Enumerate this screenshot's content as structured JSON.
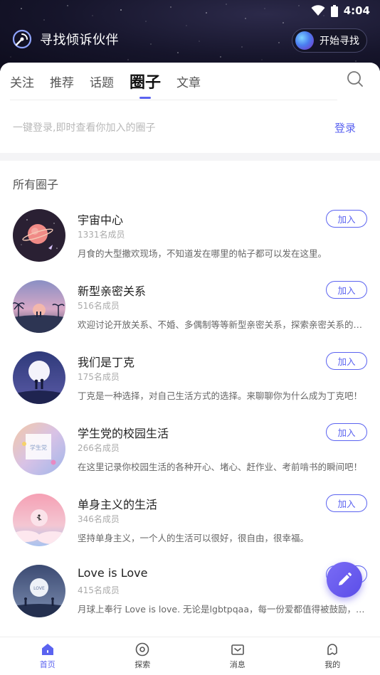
{
  "status_bar": {
    "time": "4:04"
  },
  "header": {
    "app_title": "寻找倾诉伙伴",
    "start_button_label": "开始寻找"
  },
  "tabs": [
    {
      "label": "关注",
      "active": false
    },
    {
      "label": "推荐",
      "active": false
    },
    {
      "label": "话题",
      "active": false
    },
    {
      "label": "圈子",
      "active": true
    },
    {
      "label": "文章",
      "active": false
    }
  ],
  "login_bar": {
    "hint": "一键登录,即时查看你加入的圈子",
    "link_label": "登录"
  },
  "section_title": "所有圈子",
  "circles": [
    {
      "name": "宇宙中心",
      "members": "1331名成员",
      "description": "月食的大型撒欢现场，不知道发在哪里的帖子都可以发在这里。",
      "join_label": "加入",
      "avatar": "planet-scene"
    },
    {
      "name": "新型亲密关系",
      "members": "516名成员",
      "description": "欢迎讨论开放关系、不婚、多偶制等等新型亲密关系，探索亲密关系的多种可能。",
      "join_label": "加入",
      "avatar": "sunset-palm-scene"
    },
    {
      "name": "我们是丁克",
      "members": "175名成员",
      "description": "丁克是一种选择，对自己生活方式的选择。来聊聊你为什么成为丁克吧！",
      "join_label": "加入",
      "avatar": "moon-couple-scene"
    },
    {
      "name": "学生党的校园生活",
      "members": "266名成员",
      "description": "在这里记录你校园生活的各种开心、堵心、赶作业、考前啃书的瞬间吧！",
      "join_label": "加入",
      "avatar": "campus-scene",
      "avatar_text": "学生党"
    },
    {
      "name": "单身主义的生活",
      "members": "346名成员",
      "description": "坚持单身主义，一个人的生活可以很好，很自由，很幸福。",
      "join_label": "加入",
      "avatar": "pink-cloud-scene"
    },
    {
      "name": "Love is Love",
      "members": "415名成员",
      "description": "月球上奉行 Love is love. 无论是lgbtpqaa，每一份爱都值得被鼓励，被祝福。",
      "join_label": "加入",
      "avatar": "love-scene",
      "avatar_text": "LOVE"
    }
  ],
  "bottom_nav": [
    {
      "label": "首页",
      "icon": "home-icon",
      "active": true
    },
    {
      "label": "探索",
      "icon": "compass-icon",
      "active": false
    },
    {
      "label": "消息",
      "icon": "mail-icon",
      "active": false
    },
    {
      "label": "我的",
      "icon": "ghost-icon",
      "active": false
    }
  ],
  "colors": {
    "accent": "#5b63f0",
    "header_bg": "#16152b",
    "fab": "#6a5cf0"
  }
}
